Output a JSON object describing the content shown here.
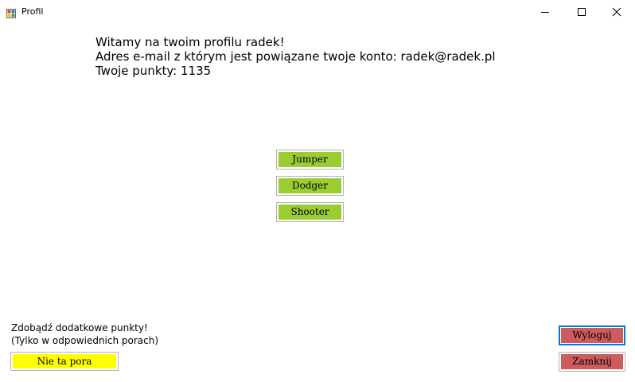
{
  "window": {
    "title": "Profil"
  },
  "profile": {
    "welcome_line": "Witamy na twoim profilu radek!",
    "email_line": "Adres e-mail z którym jest powiązane twoje konto: radek@radek.pl",
    "points_line": "Twoje punkty: 1135"
  },
  "games": {
    "jumper_label": "Jumper",
    "dodger_label": "Dodger",
    "shooter_label": "Shooter",
    "button_color": "#9acd32"
  },
  "bonus": {
    "line1": "Zdobądź dodatkowe punkty!",
    "line2": "(Tylko w odpowiednich porach)",
    "button_label": "Nie ta pora",
    "button_color": "#ffff00"
  },
  "actions": {
    "logout_label": "Wyloguj",
    "close_label": "Zamknij",
    "button_color": "#cd5c5c",
    "focus_color": "#0078d7"
  },
  "icons": {
    "app": "app-icon",
    "minimize": "minimize-icon",
    "maximize": "maximize-icon",
    "close": "close-icon"
  }
}
